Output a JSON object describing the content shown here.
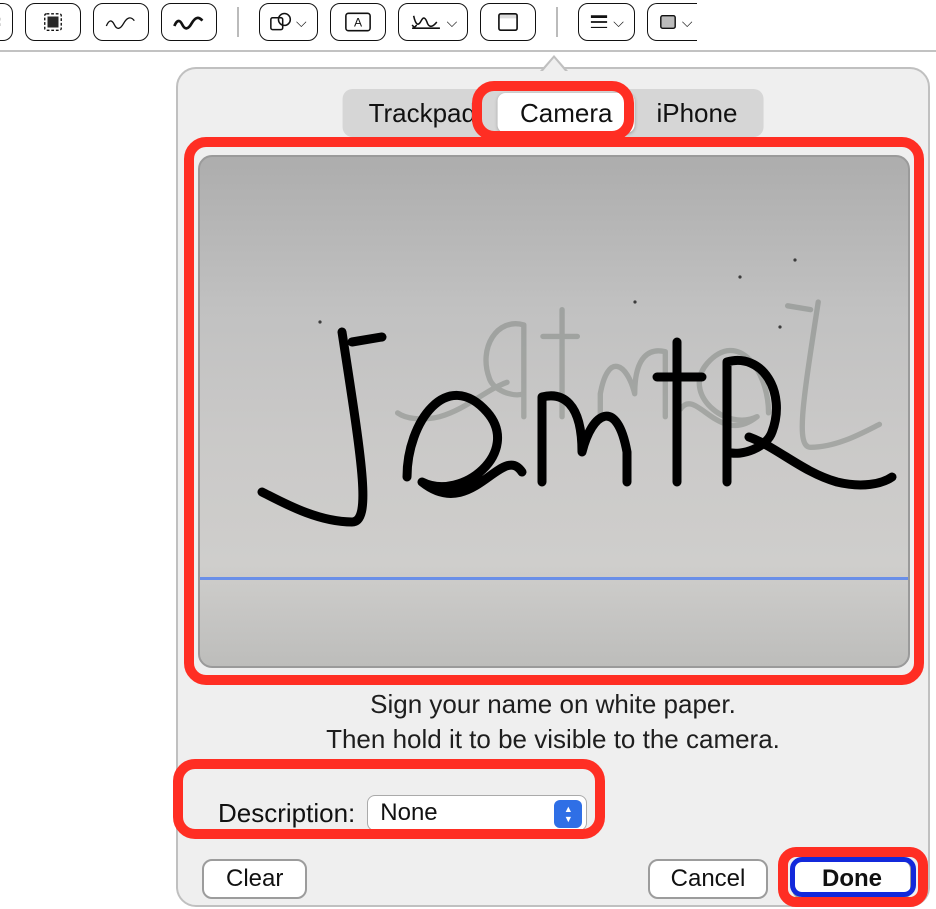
{
  "toolbar": {
    "icons": {
      "crop": "crop-icon",
      "select": "selection-icon",
      "sketch_thin": "sketch-thin-icon",
      "sketch_thick": "sketch-thick-icon",
      "shapes": "shapes-icon",
      "text": "text-box-icon",
      "sign": "signature-icon",
      "note": "note-icon",
      "border_style": "border-style-icon",
      "fill_color": "fill-color-icon"
    }
  },
  "dialog": {
    "tabs": {
      "trackpad": "Trackpad",
      "camera": "Camera",
      "iphone": "iPhone",
      "selected": "camera"
    },
    "instructions_line1": "Sign your name on white paper.",
    "instructions_line2": "Then hold it to be visible to the camera.",
    "description_label": "Description:",
    "description_value": "None",
    "buttons": {
      "clear": "Clear",
      "cancel": "Cancel",
      "done": "Done"
    },
    "signature_text": "JSmith"
  }
}
